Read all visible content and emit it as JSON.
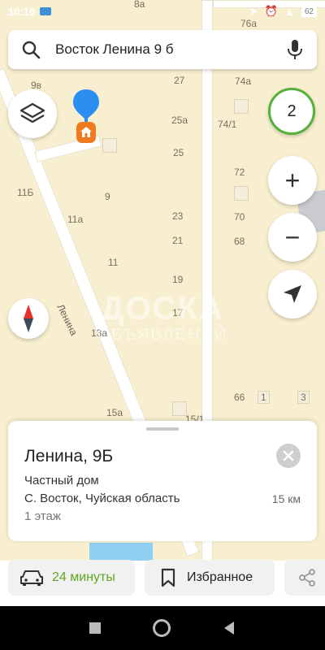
{
  "status": {
    "time": "10:10",
    "battery": "62"
  },
  "search": {
    "query": "Восток Ленина 9 б"
  },
  "map": {
    "street": "Ленина",
    "watermark_line1": "ДОСКА",
    "watermark_line2": "ОБЪЯВЛЕНИЙ",
    "cluster_count": "2",
    "house_numbers": [
      "8а",
      "76а",
      "9в",
      "27",
      "74а",
      "25а",
      "74/1",
      "25",
      "72",
      "11Б",
      "9",
      "23",
      "70",
      "11а",
      "21",
      "68",
      "11",
      "19",
      "17",
      "13а",
      "66",
      "1",
      "3",
      "15а",
      "15/1"
    ]
  },
  "card": {
    "title": "Ленина, 9Б",
    "type": "Частный дом",
    "address": "С. Восток, Чуйская область",
    "distance": "15 км",
    "floors": "1 этаж"
  },
  "actions": {
    "route_label": "24 минуты",
    "favorite_label": "Избранное"
  },
  "colors": {
    "route_green": "#5fa620",
    "cluster_ring": "#57b03a",
    "pin_blue": "#2b8ff2",
    "pin_orange": "#f07b1e"
  }
}
